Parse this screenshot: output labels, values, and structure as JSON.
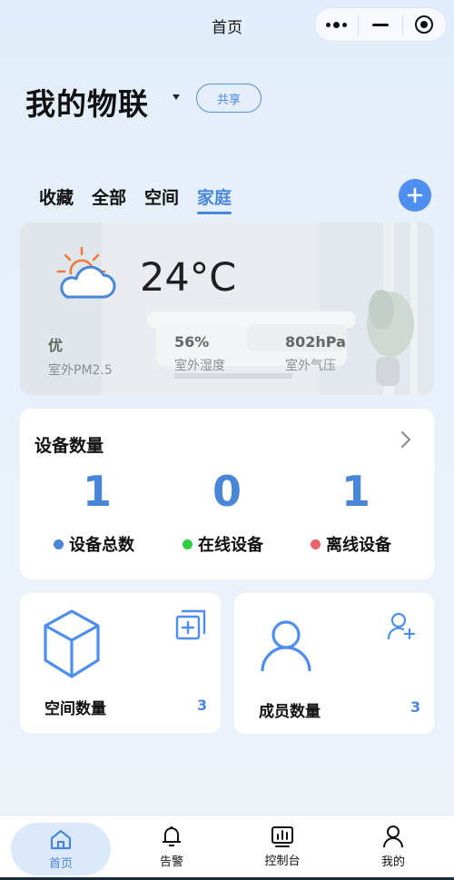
{
  "navbar": {
    "title": "首页"
  },
  "header": {
    "title": "我的物联",
    "share_label": "共享"
  },
  "tabs": [
    {
      "label": "收藏",
      "active": false
    },
    {
      "label": "全部",
      "active": false
    },
    {
      "label": "空间",
      "active": false
    },
    {
      "label": "家庭",
      "active": true
    }
  ],
  "weather": {
    "icon": "partly-cloudy-sun-icon",
    "temperature": "24°C",
    "stats": [
      {
        "value": "优",
        "label": "室外PM2.5"
      },
      {
        "value": "56%",
        "label": "室外湿度"
      },
      {
        "value": "802hPa",
        "label": "室外气压"
      }
    ]
  },
  "devices": {
    "title": "设备数量",
    "total": "1",
    "online": "0",
    "offline": "1",
    "total_label": "设备总数",
    "online_label": "在线设备",
    "offline_label": "离线设备",
    "colors": {
      "total": "#4a86d8",
      "online": "#2ecc40",
      "offline": "#e8636a"
    }
  },
  "space_card": {
    "label": "空间数量",
    "count": "3",
    "icon": "cube-icon",
    "action_icon": "add-copy-icon"
  },
  "member_card": {
    "label": "成员数量",
    "count": "3",
    "icon": "user-icon",
    "action_icon": "add-user-icon"
  },
  "tabbar": [
    {
      "label": "首页",
      "icon": "home-icon",
      "active": true
    },
    {
      "label": "告警",
      "icon": "bell-icon",
      "active": false
    },
    {
      "label": "控制台",
      "icon": "dashboard-icon",
      "active": false
    },
    {
      "label": "我的",
      "icon": "profile-icon",
      "active": false
    }
  ],
  "accent_color": "#4a86d8"
}
